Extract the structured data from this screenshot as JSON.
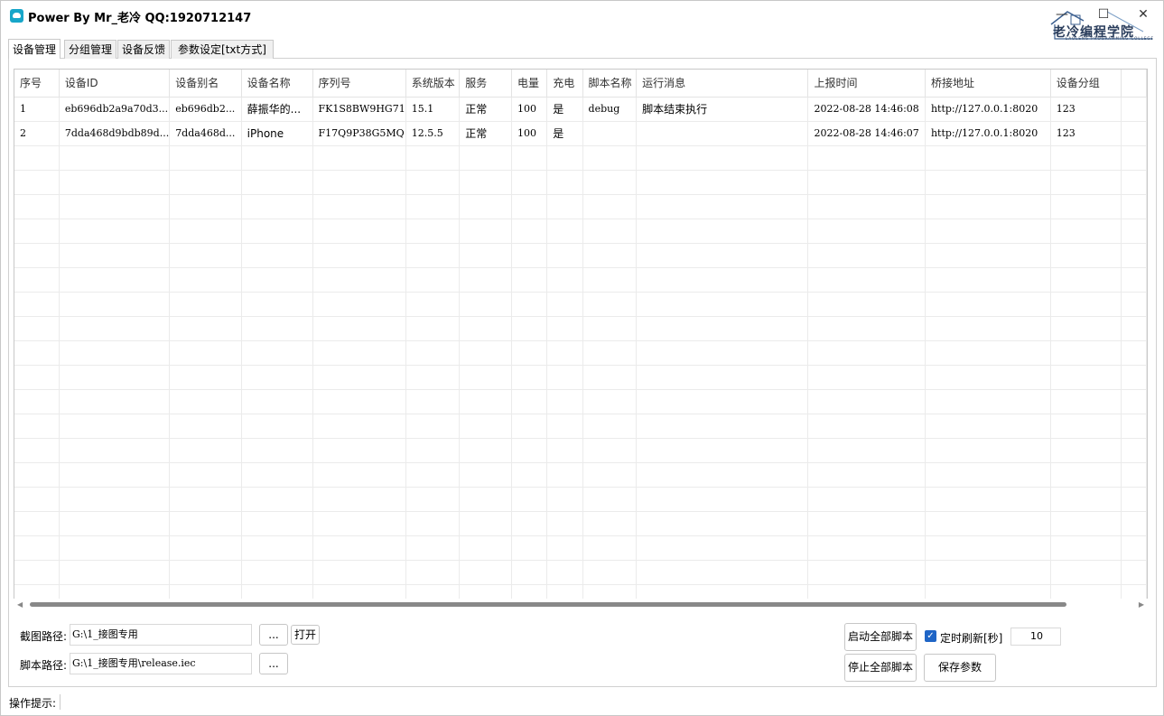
{
  "window": {
    "title": "Power By Mr_老冷 QQ:1920712147",
    "logo_text": "老冷编程学院",
    "logo_sub": "LAOLENG PROGRAMMING COLLEGE",
    "min_glyph": "—",
    "max_glyph": "☐",
    "close_glyph": "✕"
  },
  "tabs": [
    {
      "label": "设备管理",
      "active": true
    },
    {
      "label": "分组管理",
      "active": false
    },
    {
      "label": "设备反馈",
      "active": false
    },
    {
      "label": "参数设定[txt方式]",
      "active": false
    }
  ],
  "grid": {
    "columns": [
      "序号",
      "设备ID",
      "设备别名",
      "设备名称",
      "序列号",
      "系统版本",
      "服务",
      "电量",
      "充电",
      "脚本名称",
      "运行消息",
      "上报时间",
      "桥接地址",
      "设备分组",
      ""
    ],
    "rows": [
      [
        "1",
        "eb696db2a9a70d3...",
        "eb696db2...",
        "薛振华的...",
        "FK1S8BW9HG71",
        "15.1",
        "正常",
        "100",
        "是",
        "debug",
        "脚本结束执行",
        "2022-08-28 14:46:08",
        "http://127.0.0.1:8020",
        "123",
        ""
      ],
      [
        "2",
        "7dda468d9bdb89d...",
        "7dda468d...",
        "iPhone",
        "F17Q9P38G5MQ",
        "12.5.5",
        "正常",
        "100",
        "是",
        "",
        "",
        "2022-08-28 14:46:07",
        "http://127.0.0.1:8020",
        "123",
        ""
      ]
    ],
    "empty_row_count": 19
  },
  "controls": {
    "screenshot_path_label": "截图路径:",
    "screenshot_path_value": "G:\\1_接图专用",
    "browse_label": "...",
    "open_label": "打开",
    "script_path_label": "脚本路径:",
    "script_path_value": "G:\\1_接图专用\\release.iec",
    "start_all_label": "启动全部脚本",
    "stop_all_label": "停止全部脚本",
    "auto_refresh_label": "定时刷新[秒]",
    "auto_refresh_checked": true,
    "refresh_interval": "10",
    "save_params_label": "保存参数"
  },
  "status": {
    "label": "操作提示:"
  }
}
